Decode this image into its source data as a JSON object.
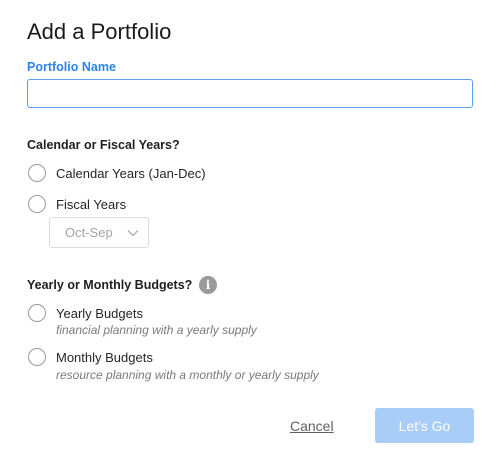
{
  "dialog": {
    "title": "Add a Portfolio"
  },
  "portfolio_name": {
    "label": "Portfolio Name",
    "value": "",
    "placeholder": ""
  },
  "years": {
    "heading": "Calendar or Fiscal Years?",
    "options": [
      {
        "label": "Calendar Years (Jan-Dec)",
        "selected": false
      },
      {
        "label": "Fiscal Years",
        "selected": false
      }
    ],
    "fiscal_select": {
      "value": "Oct-Sep",
      "enabled": false
    }
  },
  "budgets": {
    "heading": "Yearly or Monthly Budgets?",
    "info_icon": "info-icon",
    "options": [
      {
        "label": "Yearly Budgets",
        "sublabel": "financial planning with a yearly supply",
        "selected": false
      },
      {
        "label": "Monthly Budgets",
        "sublabel": "resource planning with a monthly or yearly supply",
        "selected": false
      }
    ]
  },
  "actions": {
    "cancel_label": "Cancel",
    "submit_label": "Let's Go",
    "submit_enabled": false
  },
  "colors": {
    "accent": "#2d84e6",
    "submit_disabled": "#a8cdf7"
  }
}
